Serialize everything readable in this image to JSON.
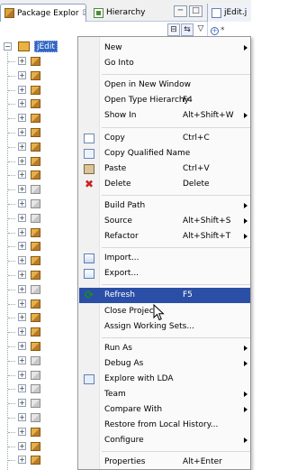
{
  "tabs": {
    "package_explorer": {
      "label": "Package Explor",
      "close": "☒"
    },
    "hierarchy": {
      "label": "Hierarchy"
    },
    "editor": {
      "label": "jEdit.j"
    }
  },
  "window_buttons": {
    "minimize": "─",
    "maximize": "□"
  },
  "toolbar": {
    "collapse": "⊟",
    "link": "⇆",
    "menu": "▽"
  },
  "tree": {
    "project_label": "jEdit"
  },
  "editor": {
    "mark": "+",
    "star": "*"
  },
  "menu": {
    "items": [
      {
        "label": "New",
        "accel": "",
        "submenu": true
      },
      {
        "label": "Go Into",
        "accel": "",
        "submenu": false
      },
      {
        "label": "Open in New Window",
        "accel": "",
        "submenu": false
      },
      {
        "label": "Open Type Hierarchy",
        "accel": "F4",
        "submenu": false
      },
      {
        "label": "Show In",
        "accel": "Alt+Shift+W",
        "submenu": true
      },
      {
        "label": "Copy",
        "accel": "Ctrl+C",
        "submenu": false,
        "icon": "copy-icon"
      },
      {
        "label": "Copy Qualified Name",
        "accel": "",
        "submenu": false,
        "icon": "copy-qualified-name-icon"
      },
      {
        "label": "Paste",
        "accel": "Ctrl+V",
        "submenu": false,
        "icon": "paste-icon"
      },
      {
        "label": "Delete",
        "accel": "Delete",
        "submenu": false,
        "icon": "delete-icon"
      },
      {
        "label": "Build Path",
        "accel": "",
        "submenu": true
      },
      {
        "label": "Source",
        "accel": "Alt+Shift+S",
        "submenu": true
      },
      {
        "label": "Refactor",
        "accel": "Alt+Shift+T",
        "submenu": true
      },
      {
        "label": "Import...",
        "accel": "",
        "submenu": false,
        "icon": "import-icon"
      },
      {
        "label": "Export...",
        "accel": "",
        "submenu": false,
        "icon": "export-icon"
      },
      {
        "label": "Refresh",
        "accel": "F5",
        "submenu": false,
        "icon": "refresh-icon",
        "highlighted": true
      },
      {
        "label": "Close Project",
        "accel": "",
        "submenu": false
      },
      {
        "label": "Assign Working Sets...",
        "accel": "",
        "submenu": false
      },
      {
        "label": "Run As",
        "accel": "",
        "submenu": true
      },
      {
        "label": "Debug As",
        "accel": "",
        "submenu": true
      },
      {
        "label": "Explore with LDA",
        "accel": "",
        "submenu": false,
        "icon": "lda-icon"
      },
      {
        "label": "Team",
        "accel": "",
        "submenu": true
      },
      {
        "label": "Compare With",
        "accel": "",
        "submenu": true
      },
      {
        "label": "Restore from Local History...",
        "accel": "",
        "submenu": false
      },
      {
        "label": "Configure",
        "accel": "",
        "submenu": true
      },
      {
        "label": "Properties",
        "accel": "Alt+Enter",
        "submenu": false
      }
    ]
  },
  "colors": {
    "highlight": "#2b4fa6",
    "selection": "#3167c4"
  }
}
